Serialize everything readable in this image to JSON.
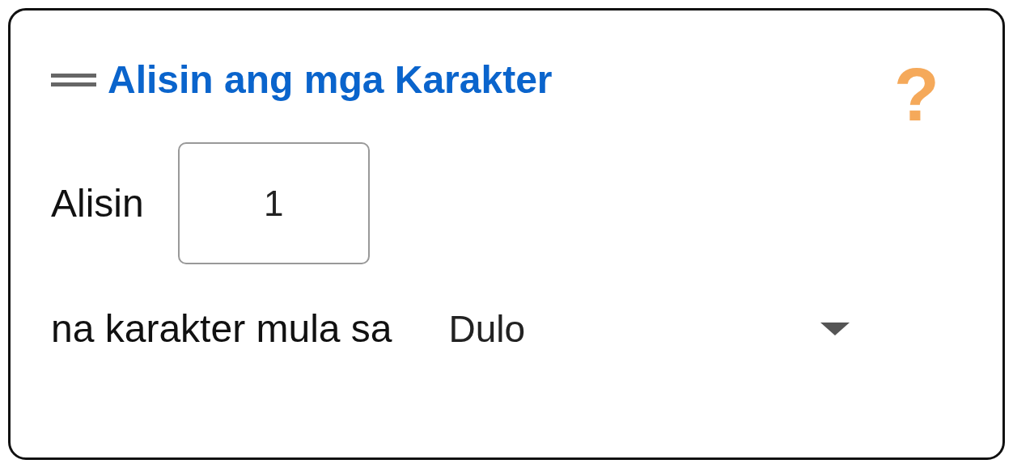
{
  "block": {
    "title": "Alisin ang mga Karakter",
    "help": "?"
  },
  "remove_row": {
    "label": "Alisin",
    "value": "1"
  },
  "from_row": {
    "label": "na karakter mula sa",
    "dropdown": {
      "value": "Dulo"
    }
  }
}
